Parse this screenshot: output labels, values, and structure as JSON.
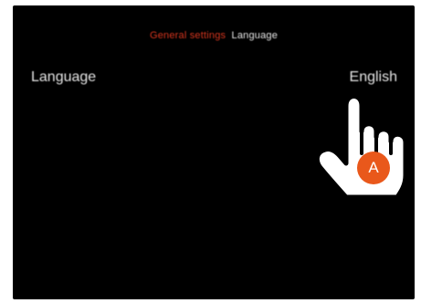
{
  "breadcrumb": {
    "parent": "General settings",
    "current": "Language"
  },
  "setting": {
    "label": "Language",
    "value": "English"
  },
  "annotation": {
    "marker_label": "A",
    "marker_color": "#e9581b",
    "pointer_icon": "hand-pointer-icon"
  },
  "colors": {
    "background": "#000000",
    "breadcrumb_parent": "#d4351e",
    "text": "#e6e6e6"
  }
}
